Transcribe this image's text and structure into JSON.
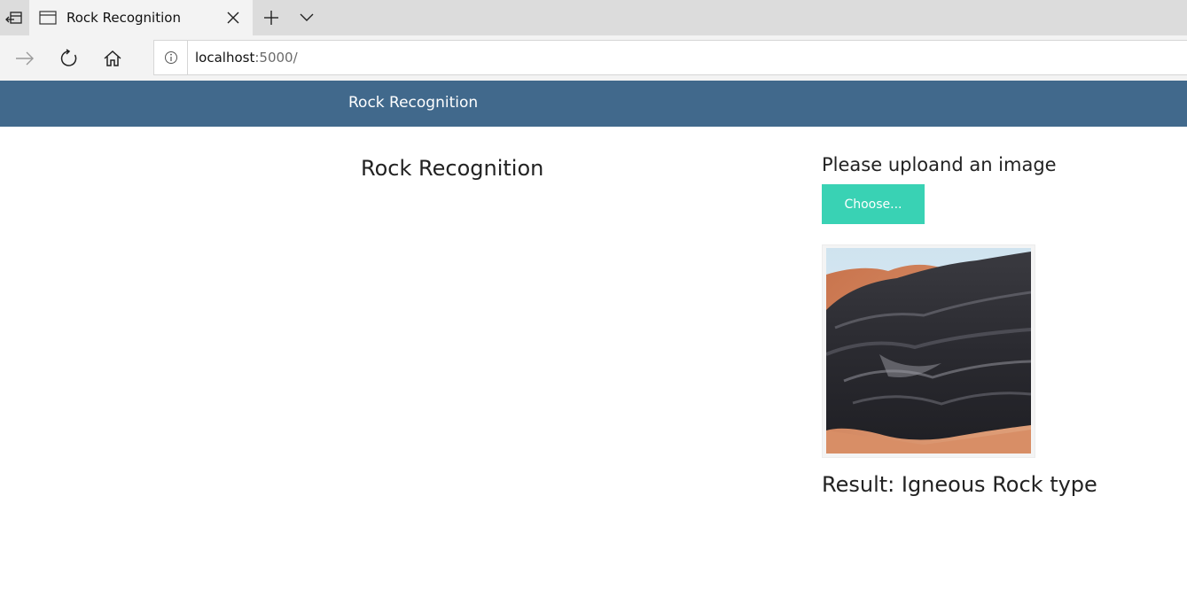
{
  "browser": {
    "tab": {
      "title": "Rock Recognition"
    },
    "address": {
      "host": "localhost",
      "port_path": ":5000/"
    },
    "icons": {
      "tab_back": "tab-list-back-icon",
      "tab_page": "page-icon",
      "tab_close": "close-icon",
      "new_tab": "plus-icon",
      "tab_menu": "chevron-down-icon",
      "forward": "arrow-right-icon",
      "refresh": "refresh-icon",
      "home": "home-icon",
      "site_info": "info-icon"
    }
  },
  "site": {
    "brand": "Rock Recognition",
    "header_color": "#41698c"
  },
  "main": {
    "title": "Rock Recognition"
  },
  "upload": {
    "heading": "Please uploand an image",
    "button_label": "Choose...",
    "button_color": "#39d2b4",
    "preview_alt": "Uploaded rock image"
  },
  "result": {
    "text": "Result: Igneous Rock type"
  }
}
